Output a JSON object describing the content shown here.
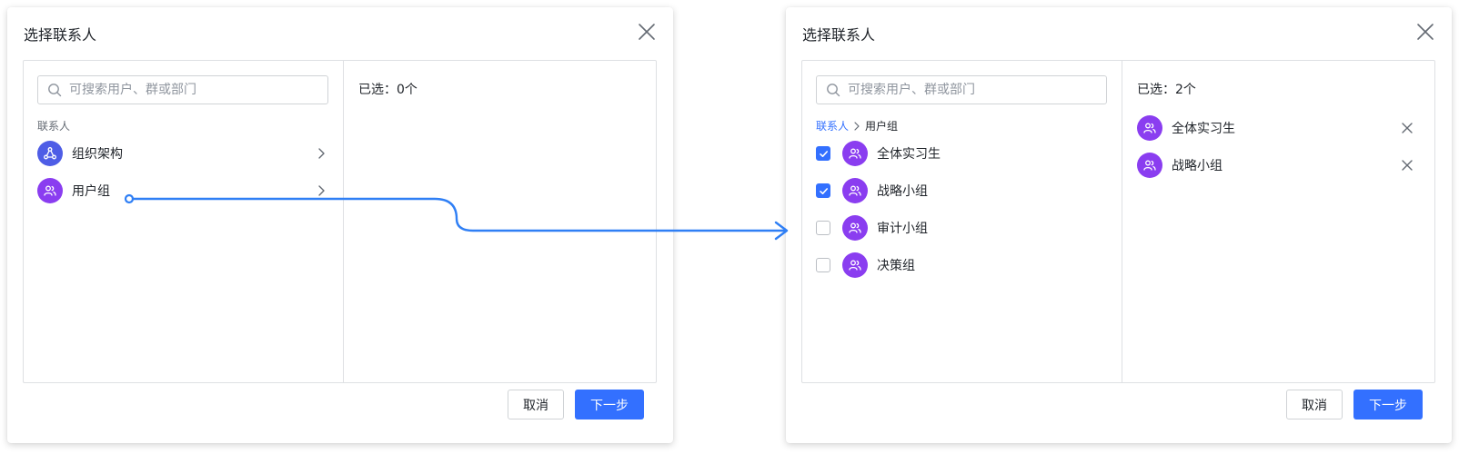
{
  "colors": {
    "accent": "#3370ff",
    "org_avatar": "#4e5de6",
    "group_avatar": "#8a3df0",
    "border": "#dee0e3",
    "muted_text": "#646a73"
  },
  "dialog_left": {
    "title": "选择联系人",
    "search_placeholder": "可搜索用户、群或部门",
    "section_label": "联系人",
    "nav_items": [
      {
        "label": "组织架构",
        "icon": "org-chart-icon"
      },
      {
        "label": "用户组",
        "icon": "user-group-icon"
      }
    ],
    "selected_count": "已选：0个",
    "cancel_label": "取消",
    "next_label": "下一步"
  },
  "dialog_right": {
    "title": "选择联系人",
    "search_placeholder": "可搜索用户、群或部门",
    "breadcrumb": {
      "root": "联系人",
      "current": "用户组"
    },
    "groups": [
      {
        "label": "全体实习生",
        "checked": true
      },
      {
        "label": "战略小组",
        "checked": true
      },
      {
        "label": "审计小组",
        "checked": false
      },
      {
        "label": "决策组",
        "checked": false
      }
    ],
    "selected_count": "已选：2个",
    "selected_items": [
      {
        "label": "全体实习生"
      },
      {
        "label": "战略小组"
      }
    ],
    "cancel_label": "取消",
    "next_label": "下一步"
  }
}
